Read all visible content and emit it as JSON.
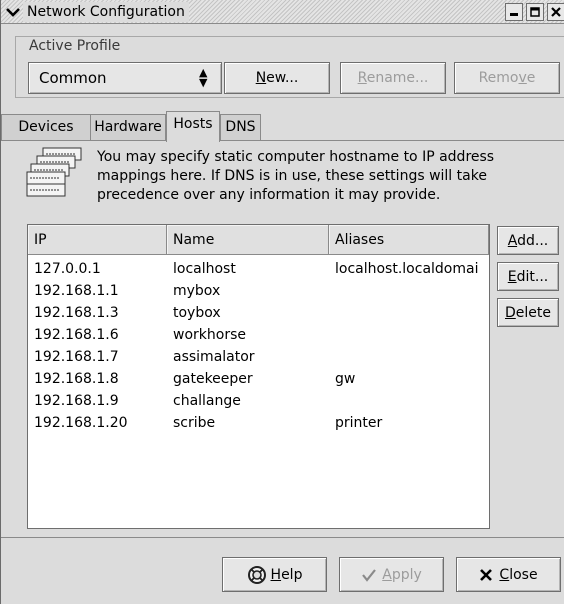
{
  "window": {
    "title": "Network Configuration"
  },
  "profile": {
    "frame_label": "Active Profile",
    "selected": "Common",
    "new_label": "New...",
    "rename_label": "Rename...",
    "remove_label": "Remove"
  },
  "tabs": [
    {
      "label": "Devices",
      "active": false
    },
    {
      "label": "Hardware",
      "active": false
    },
    {
      "label": "Hosts",
      "active": true
    },
    {
      "label": "DNS",
      "active": false
    }
  ],
  "hosts": {
    "description": "You may specify static computer hostname to IP address mappings here.  If DNS is in use, these settings will take precedence over any information it may provide.",
    "columns": [
      "IP",
      "Name",
      "Aliases"
    ],
    "rows": [
      {
        "ip": "127.0.0.1",
        "name": "localhost",
        "aliases": "localhost.localdomai"
      },
      {
        "ip": "192.168.1.1",
        "name": "mybox",
        "aliases": ""
      },
      {
        "ip": "192.168.1.3",
        "name": "toybox",
        "aliases": ""
      },
      {
        "ip": "192.168.1.6",
        "name": "workhorse",
        "aliases": ""
      },
      {
        "ip": "192.168.1.7",
        "name": "assimalator",
        "aliases": ""
      },
      {
        "ip": "192.168.1.8",
        "name": "gatekeeper",
        "aliases": "gw"
      },
      {
        "ip": "192.168.1.9",
        "name": "challange",
        "aliases": ""
      },
      {
        "ip": "192.168.1.20",
        "name": "scribe",
        "aliases": "printer"
      }
    ],
    "add_label": "Add...",
    "edit_label": "Edit...",
    "delete_label": "Delete"
  },
  "footer": {
    "help_label": "Help",
    "apply_label": "Apply",
    "close_label": "Close"
  },
  "icons": {
    "window_menu": "chevron-down-icon",
    "minimize": "minimize-icon",
    "maximize": "maximize-icon",
    "close": "close-icon",
    "info": "address-list-icon",
    "help": "lifebuoy-icon",
    "apply": "checkmark-icon",
    "close_button": "x-icon",
    "combo_arrow": "spinner-arrows-icon"
  }
}
